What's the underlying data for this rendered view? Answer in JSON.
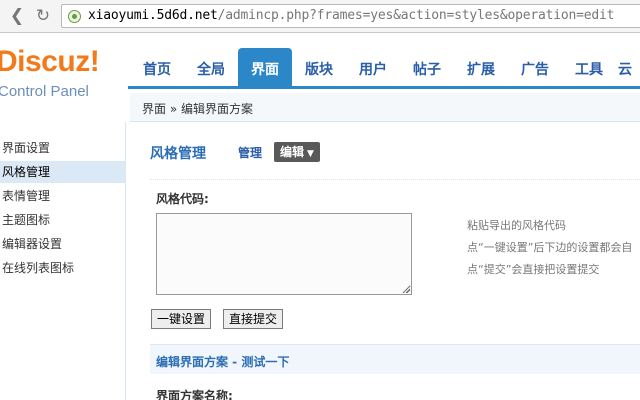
{
  "browser": {
    "url_host": "xiaoyumi.5d6d.net",
    "url_path": "/admincp.php?frames=yes&action=styles&operation=edit"
  },
  "logo": {
    "brand": "Discuz",
    "bang": "!",
    "subtitle": "Control Panel",
    "color": "#f27a1a"
  },
  "topnav": {
    "items": [
      "首页",
      "全局",
      "界面",
      "版块",
      "用户",
      "帖子",
      "扩展",
      "广告",
      "工具",
      "云"
    ],
    "active": "界面",
    "accent": "#2c87c9"
  },
  "breadcrumb": "界面 » 编辑界面方案",
  "sidebar": {
    "items": [
      "界面设置",
      "风格管理",
      "表情管理",
      "主题图标",
      "编辑器设置",
      "在线列表图标"
    ],
    "active": "风格管理"
  },
  "main": {
    "title": "风格管理",
    "tab_manage": "管理",
    "tab_edit": "编辑",
    "code_label": "风格代码:",
    "code_value": "",
    "hints": [
      "粘贴导出的风格代码",
      "点“一键设置”后下边的设置都会自",
      "点“提交”会直接把设置提交"
    ],
    "button_onekey": "一键设置",
    "button_submit": "直接提交",
    "section_title": "编辑界面方案 - 测试一下",
    "scheme_name_label": "界面方案名称:"
  }
}
